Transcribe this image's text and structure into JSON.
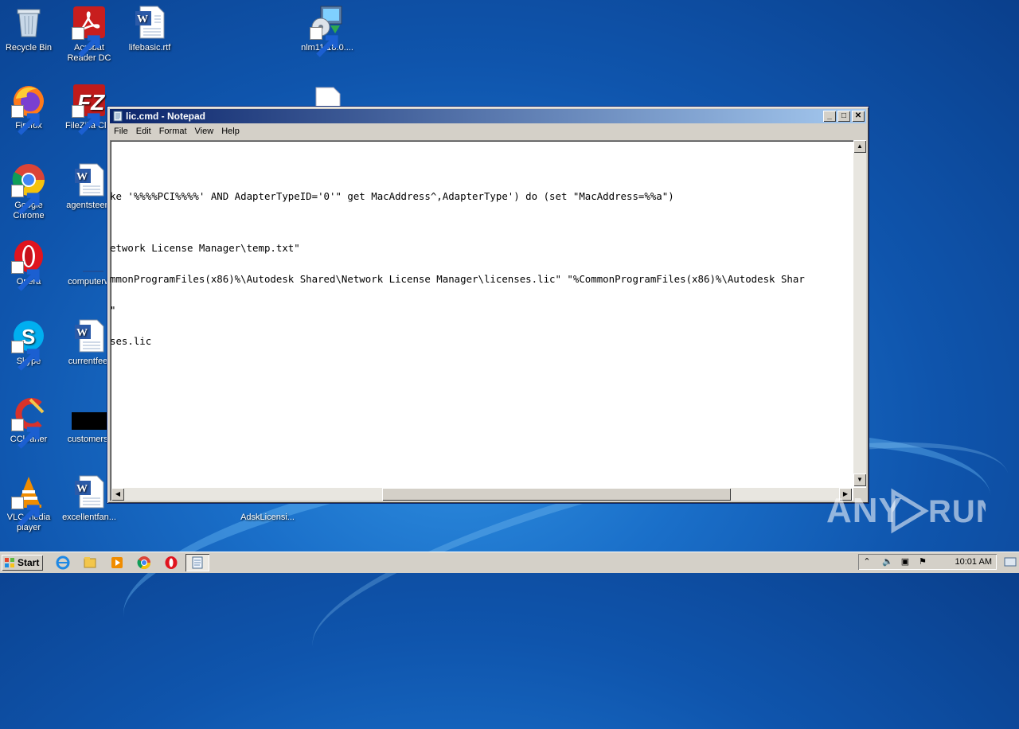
{
  "desktop_icons": [
    {
      "label": "Recycle Bin"
    },
    {
      "label": "Acrobat Reader DC"
    },
    {
      "label": "lifebasic.rtf"
    },
    {
      "label": "nlm11.18.0...."
    },
    {
      "label": "Firefox"
    },
    {
      "label": "FileZilla Clie"
    },
    {
      "label": "Google Chrome"
    },
    {
      "label": "agentsteem"
    },
    {
      "label": "Opera"
    },
    {
      "label": "computerw"
    },
    {
      "label": "Skype"
    },
    {
      "label": "currentfee."
    },
    {
      "label": "CCleaner"
    },
    {
      "label": "customersr"
    },
    {
      "label": "VLC media player"
    },
    {
      "label": "excellentfan..."
    },
    {
      "label": "AdskLicensi..."
    }
  ],
  "notepad": {
    "title": "lic.cmd - Notepad",
    "menu": [
      "File",
      "Edit",
      "Format",
      "View",
      "Help"
    ],
    "lines": [
      "",
      "ke '%%%%PCI%%%%' AND AdapterTypeID='0'\" get MacAddress^,AdapterType') do (set \"MacAddress=%%a\")",
      "",
      "etwork License Manager\\temp.txt\"",
      "mmonProgramFiles(x86)%\\Autodesk Shared\\Network License Manager\\licenses.lic\" \"%CommonProgramFiles(x86)%\\Autodesk Shar",
      "\"",
      "ses.lic"
    ]
  },
  "taskbar": {
    "start_label": "Start",
    "clock": "10:01 AM"
  },
  "watermark": "ANY RUN"
}
